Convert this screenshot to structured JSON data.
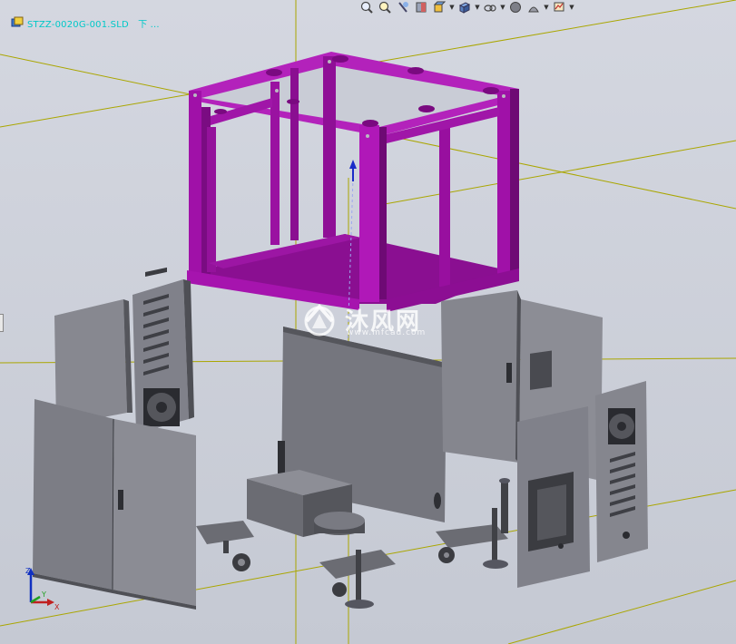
{
  "document": {
    "title": "STZZ-0020G-001.SLD　下 ...",
    "icon": "assembly-icon"
  },
  "heads_up_toolbar": {
    "buttons": [
      {
        "name": "zoom-to-fit",
        "icon": "zoom-fit-icon"
      },
      {
        "name": "zoom-to-area",
        "icon": "zoom-area-icon"
      },
      {
        "name": "previous-view",
        "icon": "previous-view-icon"
      },
      {
        "name": "section-view",
        "icon": "section-view-icon"
      },
      {
        "name": "view-orientation",
        "icon": "view-orientation-icon",
        "dropdown": true
      },
      {
        "name": "display-style",
        "icon": "display-style-icon",
        "dropdown": true
      },
      {
        "name": "hide-show-items",
        "icon": "hide-show-icon",
        "dropdown": true
      },
      {
        "name": "edit-appearance",
        "icon": "appearance-icon"
      },
      {
        "name": "apply-scene",
        "icon": "scene-icon",
        "dropdown": true
      },
      {
        "name": "view-settings",
        "icon": "view-settings-icon",
        "dropdown": true
      }
    ]
  },
  "watermark": {
    "text": "沐风网",
    "url": "www.mfcad.com"
  },
  "triad": {
    "x_label": "X",
    "y_label": "Y",
    "z_label": "Z"
  },
  "colors": {
    "frame": "#a011a8",
    "frame_dark": "#6e0a74",
    "panel": "#7f8088",
    "panel_dark": "#55565c",
    "panel_light": "#9c9da4",
    "grid_line": "#b8b400",
    "title_text": "#00c8c8"
  }
}
